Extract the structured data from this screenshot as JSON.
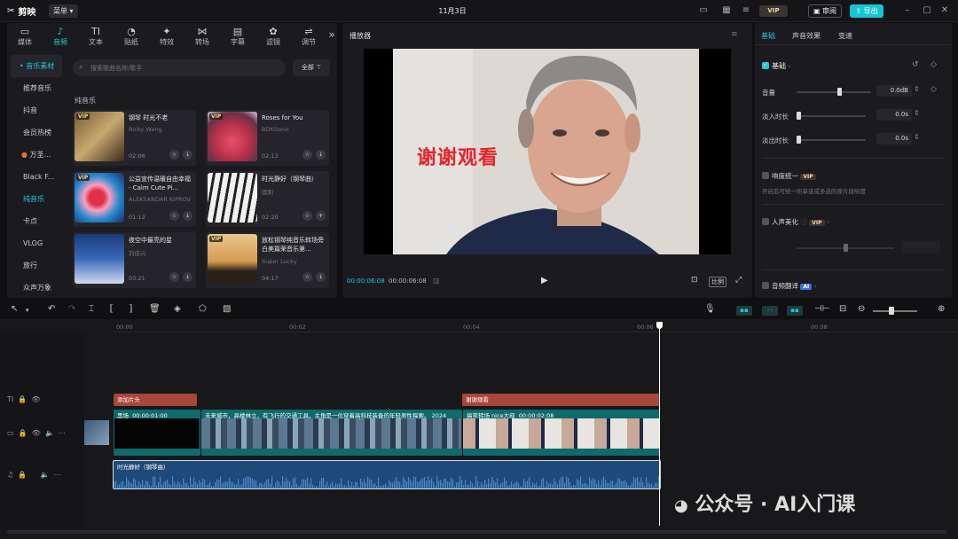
{
  "topbar": {
    "logo": "剪映",
    "menu": "菜单",
    "date": "11月3日",
    "vip": "VIP",
    "review": "审阅",
    "export": "导出"
  },
  "media_tabs": [
    {
      "icon": "▭",
      "label": "媒体",
      "name": "media-icon"
    },
    {
      "icon": "♪",
      "label": "音频",
      "name": "audio-icon"
    },
    {
      "icon": "TI",
      "label": "文本",
      "name": "text-icon"
    },
    {
      "icon": "◔",
      "label": "贴纸",
      "name": "sticker-icon"
    },
    {
      "icon": "✦",
      "label": "特效",
      "name": "effects-icon"
    },
    {
      "icon": "⋈",
      "label": "转场",
      "name": "transition-icon"
    },
    {
      "icon": "▤",
      "label": "字幕",
      "name": "subtitle-icon"
    },
    {
      "icon": "✿",
      "label": "滤镜",
      "name": "filter-icon"
    },
    {
      "icon": "⇌",
      "label": "调节",
      "name": "adjust-icon"
    }
  ],
  "categories": [
    "音乐素材",
    "推荐音乐",
    "抖音",
    "会员热榜",
    "万圣...",
    "Black F...",
    "纯音乐",
    "卡点",
    "VLOG",
    "旅行",
    "众声万象"
  ],
  "search": {
    "placeholder": "搜索歌曲名称/歌手",
    "filter": "全部"
  },
  "section": "纯音乐",
  "cards": [
    {
      "vip": "VIP",
      "title": "钢琴 时光不老",
      "artist": "Ricky Wang",
      "duration": "02:06"
    },
    {
      "vip": "VIP",
      "title": "Roses for You",
      "artist": "BDKSonic",
      "duration": "02:13"
    },
    {
      "vip": "VIP",
      "title": "公益宣传温暖自由幸福 - Calm Cute Pi...",
      "artist": "ALEKSANDAR KIPROV",
      "duration": "01:12"
    },
    {
      "vip": "",
      "title": "时光静好（钢琴曲）",
      "artist": "圆刺",
      "duration": "02:20"
    },
    {
      "vip": "",
      "title": "夜空中最亮的星",
      "artist": "刘佳兴",
      "duration": "03:21"
    },
    {
      "vip": "VIP",
      "title": "放松钢琴纯音乐转场旁白美篇荣音乐第...",
      "artist": "Super Lucky",
      "duration": "04:17"
    }
  ],
  "player": {
    "title": "播放器",
    "overlay_text": "谢谢观看",
    "current_time": "00:00:06:08",
    "total_time": "00:00:06:08",
    "ratio": "比例"
  },
  "props": {
    "tabs": [
      "基础",
      "声音效果",
      "变速"
    ],
    "basic": "基础",
    "volume_label": "音量",
    "volume_value": "0.0dB",
    "fadein_label": "淡入时长",
    "fadein_value": "0.0s",
    "fadeout_label": "淡出时长",
    "fadeout_value": "0.0s",
    "loudness": "响度统一",
    "loudness_desc": "开启后可统一所单选或多选的原片段响度",
    "vocal": "人声美化",
    "translate": "音频翻译",
    "ai": "AI",
    "volume_level": 0.55,
    "vocal_level": 0.48
  },
  "ruler": [
    "00:00",
    "00:02",
    "00:04",
    "00:06",
    "00:08"
  ],
  "tracks": {
    "text1": "添加片头",
    "text2": "谢谢观看",
    "main_clip1_label": "黑场",
    "main_clip1_time": "00:00:01:00",
    "main_clip2_label": "未来城市，高楼林立，有飞行的交通工具，主角是一位穿着高科技装备的年轻男性探索。 2024",
    "main_clip3_label": "搞笑转场 nice大叔",
    "main_clip3_time": "00:00:02:08",
    "audio_label": "时光静好（钢琴曲）"
  },
  "watermark": "公众号 · AI入门课"
}
